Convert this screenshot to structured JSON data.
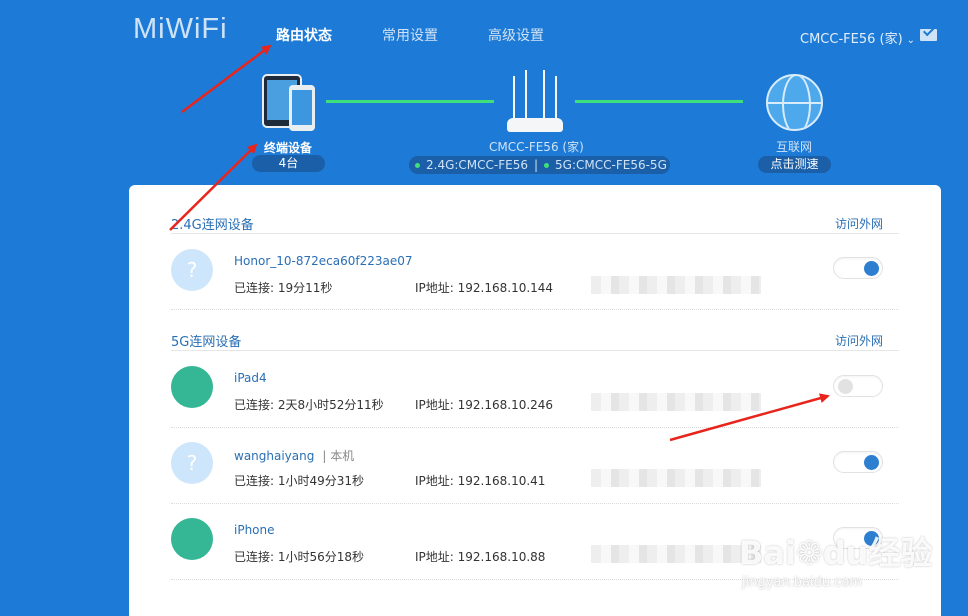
{
  "header": {
    "logo": "MiWiFi",
    "nav": [
      "路由状态",
      "常用设置",
      "高级设置"
    ],
    "account": "CMCC-FE56 (家)"
  },
  "topology": {
    "terminal_label": "终端设备",
    "terminal_count": "4台",
    "router_label": "CMCC-FE56 (家)",
    "ssid_24": "2.4G:CMCC-FE56",
    "ssid_5": "5G:CMCC-FE56-5G",
    "ssid_sep": "|",
    "internet_label": "互联网",
    "speedtest": "点击测速"
  },
  "sections": [
    {
      "title": "2.4G连网设备",
      "right": "访问外网",
      "devices": [
        {
          "name": "Honor_10-872eca60f223ae07",
          "local": "",
          "icon": "unknown-device-icon",
          "conn": "已连接: 19分11秒",
          "ip": "IP地址: 192.168.10.144",
          "internet": true
        }
      ]
    },
    {
      "title": "5G连网设备",
      "right": "访问外网",
      "devices": [
        {
          "name": "iPad4",
          "local": "",
          "icon": "apple-icon",
          "conn": "已连接: 2天8小时52分11秒",
          "ip": "IP地址: 192.168.10.246",
          "internet": false
        },
        {
          "name": "wanghaiyang",
          "local": "| 本机",
          "icon": "unknown-device-icon",
          "conn": "已连接: 1小时49分31秒",
          "ip": "IP地址: 192.168.10.41",
          "internet": true
        },
        {
          "name": "iPhone",
          "local": "",
          "icon": "apple-icon",
          "conn": "已连接: 1小时56分18秒",
          "ip": "IP地址: 192.168.10.88",
          "internet": true
        }
      ]
    }
  ],
  "glyphs": {
    "unknown": "?",
    "apple": "",
    "chevron": "⌄"
  },
  "colors": {
    "background": "#1d7ad6",
    "link": "#3fe07a",
    "toggle_on": "#2f7fd1",
    "apple": "#35b795"
  },
  "watermark": {
    "brand": "Bai",
    "brand2": "du",
    "suffix": "经验",
    "url": "jingyan.baidu.com"
  }
}
